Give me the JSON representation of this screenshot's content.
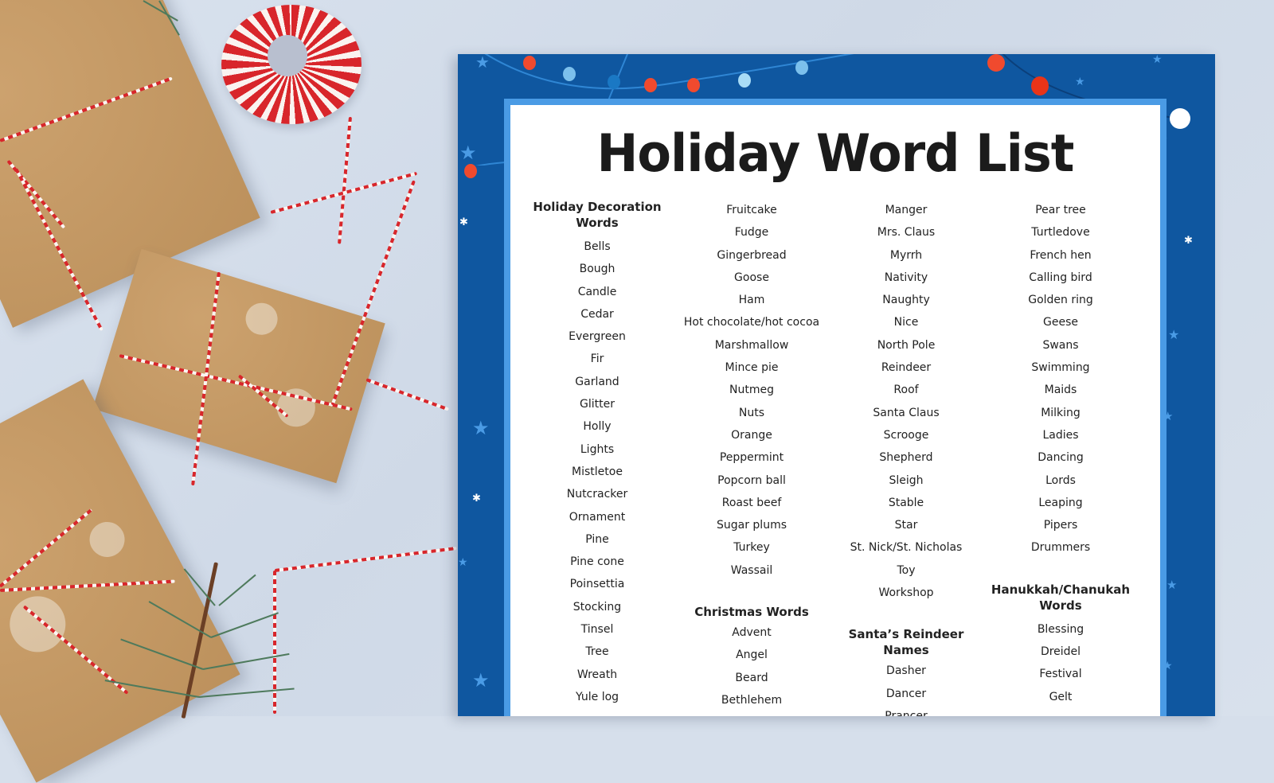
{
  "worksheet": {
    "title": "Holiday Word List",
    "colors": {
      "border_blue": "#0f57a0",
      "frame_light_blue": "#4a9be5",
      "bulb_red": "#f04a2e",
      "bulb_light_blue": "#7cc0ec",
      "bulb_mid_blue": "#1a78c4",
      "text": "#222222"
    },
    "columns": [
      {
        "sections": [
          {
            "heading": "Holiday Decoration Words",
            "words": [
              "Bells",
              "Bough",
              "Candle",
              "Cedar",
              "Evergreen",
              "Fir",
              "Garland",
              "Glitter",
              "Holly",
              "Lights",
              "Mistletoe",
              "Nutcracker",
              "Ornament",
              "Pine",
              "Pine cone",
              "Poinsettia",
              "Stocking",
              "Tinsel",
              "Tree",
              "Wreath",
              "Yule log"
            ]
          }
        ]
      },
      {
        "sections": [
          {
            "heading": "",
            "words": [
              "Fruitcake",
              "Fudge",
              "Gingerbread",
              "Goose",
              "Ham",
              "Hot chocolate/hot cocoa",
              "Marshmallow",
              "Mince pie",
              "Nutmeg",
              "Nuts",
              "Orange",
              "Peppermint",
              "Popcorn ball",
              "Roast beef",
              "Sugar plums",
              "Turkey",
              "Wassail"
            ]
          },
          {
            "heading": "Christmas Words",
            "words": [
              "Advent",
              "Angel",
              "Beard",
              "Bethlehem"
            ]
          }
        ]
      },
      {
        "sections": [
          {
            "heading": "",
            "words": [
              "Manger",
              "Mrs. Claus",
              "Myrrh",
              "Nativity",
              "Naughty",
              "Nice",
              "North Pole",
              "Reindeer",
              "Roof",
              "Santa Claus",
              "Scrooge",
              "Shepherd",
              "Sleigh",
              "Stable",
              "Star",
              "St. Nick/St. Nicholas",
              "Toy",
              "Workshop"
            ]
          },
          {
            "heading": "Santa’s Reindeer Names",
            "words": [
              "Dasher",
              "Dancer",
              "Prancer"
            ]
          }
        ]
      },
      {
        "sections": [
          {
            "heading": "",
            "words": [
              "Pear tree",
              "Turtledove",
              "French hen",
              "Calling bird",
              "Golden ring",
              "Geese",
              "Swans",
              "Swimming",
              "Maids",
              "Milking",
              "Ladies",
              "Dancing",
              "Lords",
              "Leaping",
              "Pipers",
              "Drummers"
            ]
          },
          {
            "heading": "Hanukkah/Chanukah Words",
            "words": [
              "Blessing",
              "Dreidel",
              "Festival",
              "Gelt"
            ]
          }
        ]
      }
    ]
  },
  "background": {
    "description": "Kraft-paper wrapped gifts tied with red and white baker's twine, a twine spool and a pine sprig on a pale blue surface",
    "colors": {
      "surface": "#d6dfeb",
      "kraft": "#c89a62",
      "twine_red": "#d8262b",
      "pine": "#4e7a5c"
    }
  }
}
